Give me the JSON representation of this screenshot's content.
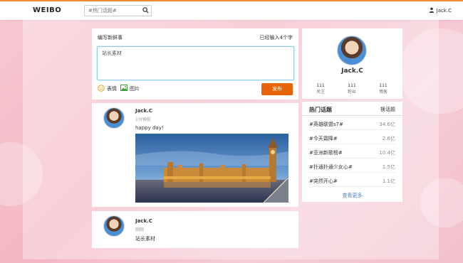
{
  "header": {
    "logo": "WEIBO",
    "search_placeholder": "#热门话题#",
    "user_name": "Jack.C"
  },
  "compose": {
    "title": "编写新鲜事",
    "counter": "已经输入4个字",
    "text": "站长素材",
    "emoji_label": "表情",
    "image_label": "图片",
    "post_button": "发布"
  },
  "posts": [
    {
      "author": "Jack.C",
      "time": "1分钟前",
      "text": "happy day!"
    },
    {
      "author": "Jack.C",
      "time": "刚刚",
      "text": "站长素材"
    }
  ],
  "profile": {
    "name": "Jack.C",
    "stats": [
      {
        "value": "111",
        "label": "关注"
      },
      {
        "value": "111",
        "label": "粉丝"
      },
      {
        "value": "111",
        "label": "博客"
      }
    ]
  },
  "topics": {
    "title": "热门话题",
    "swap_label": "换话题",
    "items": [
      {
        "name": "#英雄联盟s7#",
        "count": "34.6亿"
      },
      {
        "name": "#今天霜降#",
        "count": "2.6亿"
      },
      {
        "name": "#亚洲新歌榜#",
        "count": "10.4亿"
      },
      {
        "name": "#扑通扑通少女心#",
        "count": "1.5亿"
      },
      {
        "name": "#突然开心#",
        "count": "1.1亿"
      }
    ],
    "more_label": "查看更多"
  },
  "colors": {
    "accent": "#f08a2a",
    "post_button": "#e8630a",
    "link": "#4a86c5"
  }
}
